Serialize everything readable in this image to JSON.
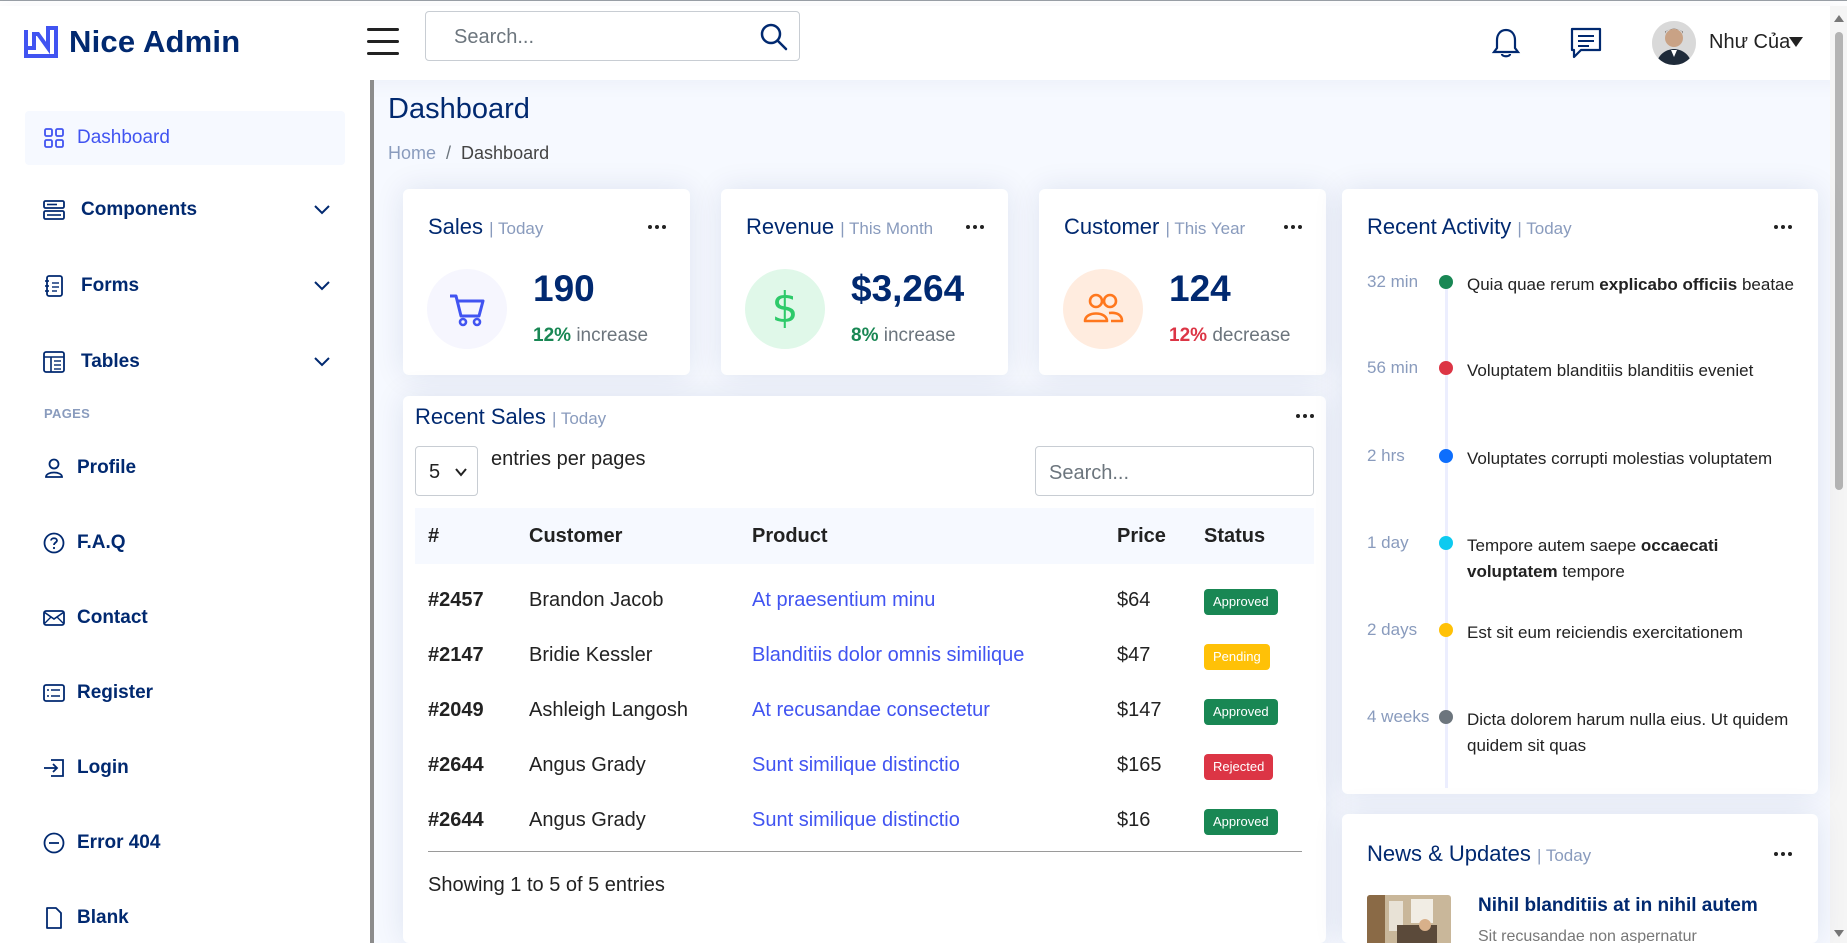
{
  "header": {
    "brand": "Nice Admin",
    "search_placeholder": "Search...",
    "user_name": "Như Của"
  },
  "sidebar": {
    "items": [
      {
        "label": "Dashboard",
        "icon": "grid-icon"
      },
      {
        "label": "Components",
        "icon": "menu-button-icon"
      },
      {
        "label": "Forms",
        "icon": "journal-text-icon"
      },
      {
        "label": "Tables",
        "icon": "layout-text-window-icon"
      }
    ],
    "pages_heading": "PAGES",
    "pages": [
      {
        "label": "Profile",
        "icon": "person-icon"
      },
      {
        "label": "F.A.Q",
        "icon": "question-circle-icon"
      },
      {
        "label": "Contact",
        "icon": "envelope-icon"
      },
      {
        "label": "Register",
        "icon": "card-list-icon"
      },
      {
        "label": "Login",
        "icon": "box-arrow-in-right-icon"
      },
      {
        "label": "Error 404",
        "icon": "dash-circle-icon"
      },
      {
        "label": "Blank",
        "icon": "file-icon"
      }
    ]
  },
  "main": {
    "title": "Dashboard",
    "breadcrumb": {
      "home": "Home",
      "current": "Dashboard"
    }
  },
  "stats": [
    {
      "title": "Sales",
      "period": "| Today",
      "value": "190",
      "pct": "12%",
      "change": "increase",
      "pct_color": "#198754",
      "icon": "cart-icon",
      "icon_bg": "#f6f6fe",
      "icon_color": "#4154f1"
    },
    {
      "title": "Revenue",
      "period": "| This Month",
      "value": "$3,264",
      "pct": "8%",
      "change": "increase",
      "pct_color": "#198754",
      "icon": "currency-dollar-icon",
      "icon_bg": "#e0f8e9",
      "icon_color": "#2eca6a"
    },
    {
      "title": "Customer",
      "period": "| This Year",
      "value": "124",
      "pct": "12%",
      "change": "decrease",
      "pct_color": "#dc3545",
      "icon": "people-icon",
      "icon_bg": "#ffecdf",
      "icon_color": "#ff771d"
    }
  ],
  "recent_sales": {
    "title": "Recent Sales",
    "period": "| Today",
    "per_page": "5",
    "per_page_label": "entries per pages",
    "search_placeholder": "Search...",
    "columns": [
      "#",
      "Customer",
      "Product",
      "Price",
      "Status"
    ],
    "rows": [
      {
        "id": "#2457",
        "customer": "Brandon Jacob",
        "product": "At praesentium minu",
        "price": "$64",
        "status": "Approved"
      },
      {
        "id": "#2147",
        "customer": "Bridie Kessler",
        "product": "Blanditiis dolor omnis similique",
        "price": "$47",
        "status": "Pending"
      },
      {
        "id": "#2049",
        "customer": "Ashleigh Langosh",
        "product": "At recusandae consectetur",
        "price": "$147",
        "status": "Approved"
      },
      {
        "id": "#2644",
        "customer": "Angus Grady",
        "product": "Sunt similique distinctio",
        "price": "$165",
        "status": "Rejected"
      },
      {
        "id": "#2644",
        "customer": "Angus Grady",
        "product": "Sunt similique distinctio",
        "price": "$16",
        "status": "Approved"
      }
    ],
    "footer": "Showing 1 to 5 of 5 entries"
  },
  "activity": {
    "title": "Recent Activity",
    "period": "| Today",
    "items": [
      {
        "time": "32 min",
        "color": "#198754",
        "text_a": "Quia quae rerum ",
        "bold": "explicabo officiis",
        "text_b": " beatae"
      },
      {
        "time": "56 min",
        "color": "#dc3545",
        "text_a": "Voluptatem blanditiis blanditiis eveniet",
        "bold": "",
        "text_b": ""
      },
      {
        "time": "2 hrs",
        "color": "#0d6efd",
        "text_a": "Voluptates corrupti molestias voluptatem",
        "bold": "",
        "text_b": ""
      },
      {
        "time": "1 day",
        "color": "#0dcaf0",
        "text_a": "Tempore autem saepe ",
        "bold": "occaecati voluptatem",
        "text_b": " tempore"
      },
      {
        "time": "2 days",
        "color": "#ffc107",
        "text_a": "Est sit eum reiciendis exercitationem",
        "bold": "",
        "text_b": ""
      },
      {
        "time": "4 weeks",
        "color": "#6c757d",
        "text_a": "Dicta dolorem harum nulla eius. Ut quidem quidem sit quas",
        "bold": "",
        "text_b": ""
      }
    ]
  },
  "news": {
    "title": "News & Updates",
    "period": "| Today",
    "item_title": "Nihil blanditiis at in nihil autem",
    "item_sub": "Sit recusandae non aspernatur"
  }
}
